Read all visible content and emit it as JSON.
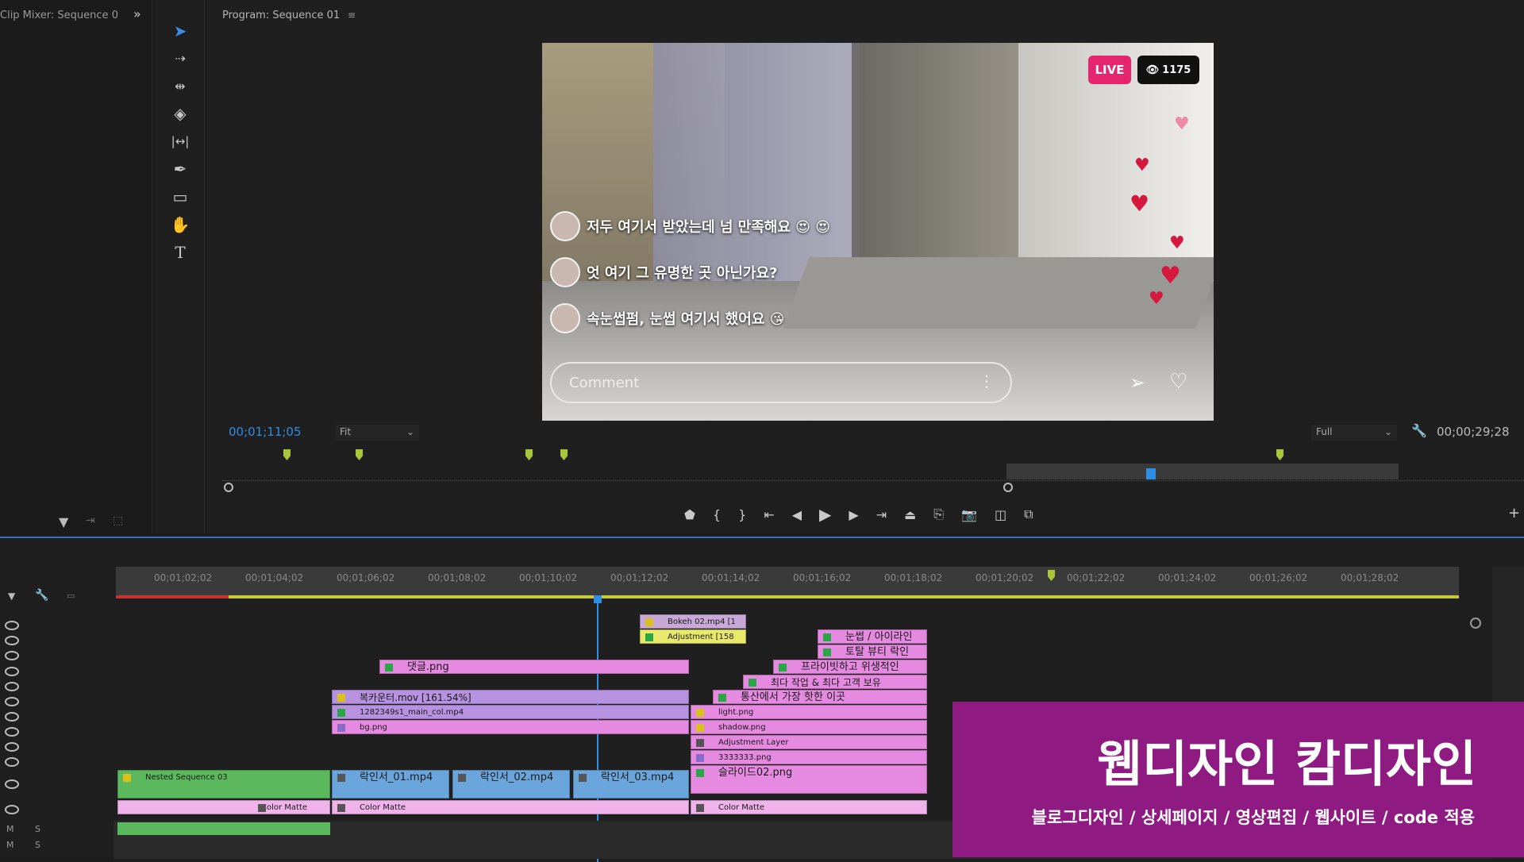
{
  "clip_mixer": {
    "title": "Clip Mixer: Sequence 0"
  },
  "tools": [
    "selection-tool",
    "track-select-tool",
    "ripple-edit-tool",
    "razor-tool",
    "slip-tool",
    "pen-tool",
    "rectangle-tool",
    "hand-tool",
    "type-tool"
  ],
  "program": {
    "title": "Program: Sequence 01",
    "timecode": "00;01;11;05",
    "zoom": "Fit",
    "quality": "Full",
    "duration": "00;00;29;28"
  },
  "video": {
    "live_badge": "LIVE",
    "viewer_count": "1175",
    "comments": [
      "저두 여기서 받았는데 넘 만족해요 😍 😍",
      "엇 여기 그 유명한 곳 아닌가요?",
      "속눈썹펌, 눈썹 여기서 했어요 😘"
    ],
    "comment_placeholder": "Comment"
  },
  "ruler_ticks": [
    "00;01;02;02",
    "00;01;04;02",
    "00;01;06;02",
    "00;01;08;02",
    "00;01;10;02",
    "00;01;12;02",
    "00;01;14;02",
    "00;01;16;02",
    "00;01;18;02",
    "00;01;20;02",
    "00;01;22;02",
    "00;01;24;02",
    "00;01;26;02",
    "00;01;28;02"
  ],
  "clips": {
    "bokeh": "Bokeh 02.mp4 [1",
    "adjustment": "Adjustment [158",
    "eyeliner": "눈썹 / 아이라인",
    "beauty": "토탈 뷰티 락인",
    "private": "프라이빗하고 위생적인",
    "comments_png": "댓글.png",
    "best_work": "최다 작업 & 최다 고객 보유",
    "counter_mov": "복카운터.mov [161.54%]",
    "hot_place": "통산에서 가장 핫한 이곳",
    "main_mp4": "1282349s1_main_col.mp4",
    "light_png": "light.png",
    "bg_png": "bg.png",
    "shadow_png": "shadow.png",
    "adj_layer": "Adjustment Layer",
    "png333": "3333333.png",
    "nested": "Nested Sequence 03",
    "lock1": "락인서_01.mp4",
    "lock2": "락인서_02.mp4",
    "lock3": "락인서_03.mp4",
    "slide": "슬라이드02.png",
    "matte": "Color Matte"
  },
  "overlay": {
    "title": "웹디자인 캄디자인",
    "subtitle": "블로그디자인 / 상세페이지 / 영상편집 / 웹사이트 / code 적용"
  },
  "colors": {
    "accent": "#2f8de4",
    "live": "#e6256f",
    "overlay": "#8e1a82"
  }
}
